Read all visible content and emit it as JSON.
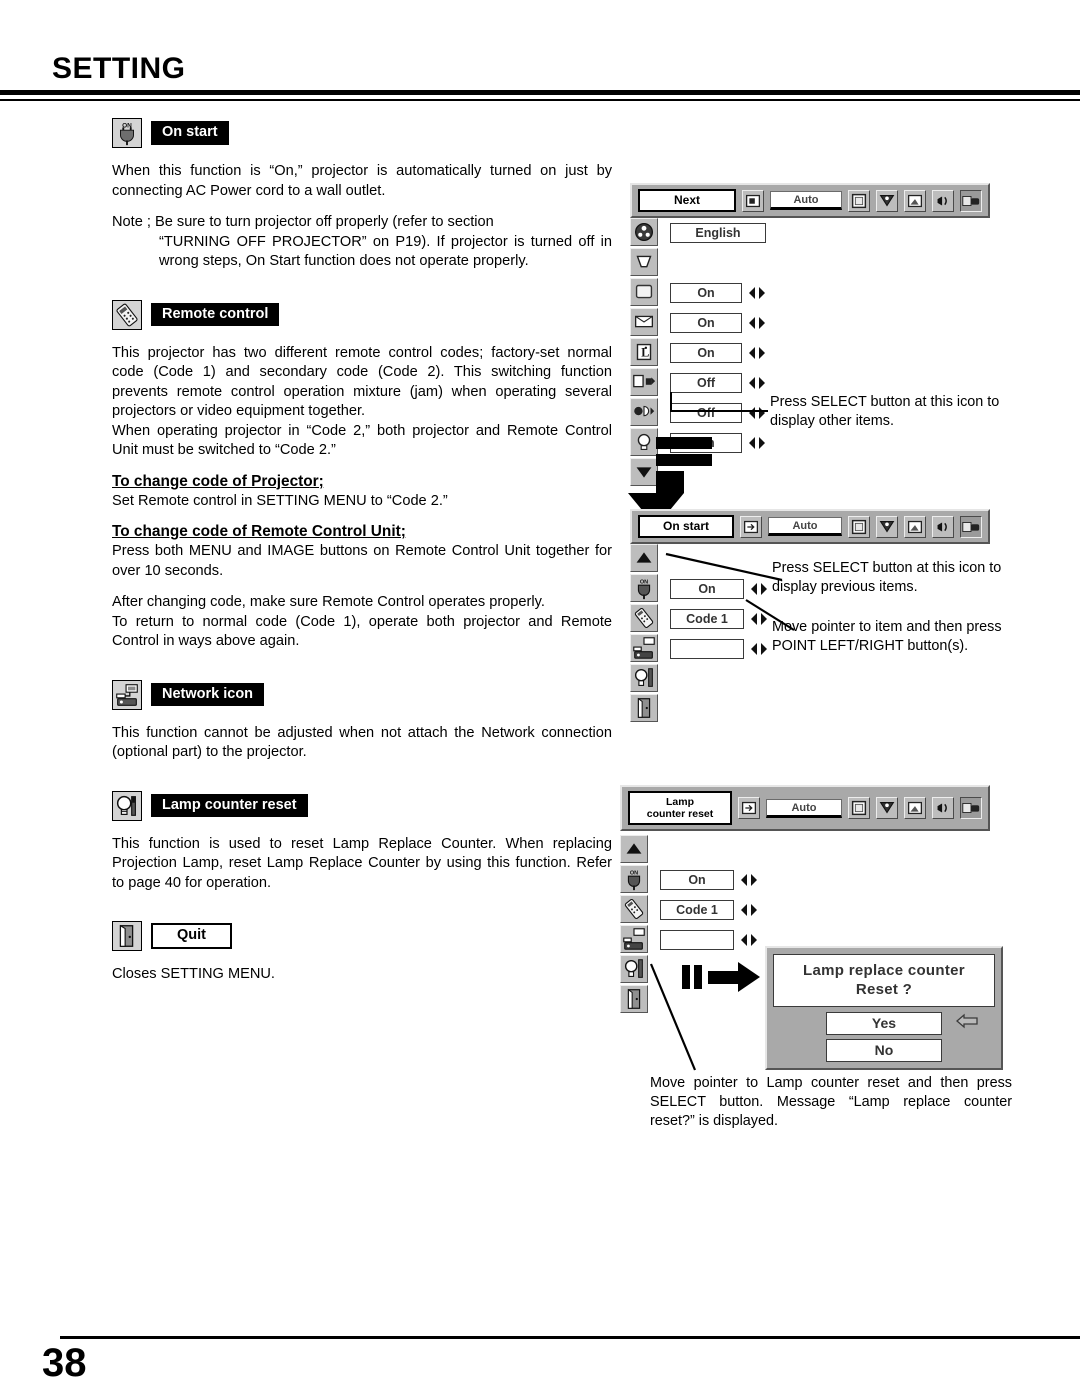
{
  "document": {
    "section_title": "SETTING",
    "page_number": "38"
  },
  "sections": [
    {
      "id": "on-start",
      "icon": "power-plug-on-icon",
      "label": "On start",
      "paragraphs": [
        "When this function is “On,” projector is automatically turned on just by connecting AC Power cord to a wall outlet."
      ],
      "note_lead": "Note ; Be sure to turn projector off properly (refer to section",
      "note_rest": "“TURNING OFF PROJECTOR” on P19).  If projector is turned off in wrong steps, On Start function does not operate properly."
    },
    {
      "id": "remote-control",
      "icon": "remote-control-icon",
      "label": "Remote control",
      "paragraphs": [
        "This projector has two different remote control codes; factory-set normal code (Code 1) and secondary code (Code 2).  This switching function prevents remote control operation mixture (jam) when operating several projectors or video equipment together.",
        "When operating projector in “Code 2,”  both projector and Remote Control Unit must be switched to “Code 2.”"
      ],
      "sub1_head": "To change code of Projector;",
      "sub1_text": "Set Remote control in SETTING MENU to “Code 2.”",
      "sub2_head": "To change code of Remote Control Unit;",
      "sub2_text": "Press both MENU and IMAGE buttons on Remote Control Unit together for over 10 seconds.",
      "after_text": "After changing code, make sure Remote Control operates properly.",
      "after_text2": "To return to normal code (Code 1), operate both projector and Remote Control in ways above again."
    },
    {
      "id": "network-icon",
      "icon": "network-projector-icon",
      "label": "Network icon",
      "paragraphs": [
        "This function cannot be adjusted when not attach the Network connection (optional part) to the projector."
      ]
    },
    {
      "id": "lamp-counter-reset",
      "icon": "lamp-tool-icon",
      "label": "Lamp counter reset",
      "paragraphs": [
        "This function is used to reset Lamp Replace Counter.  When replacing Projection Lamp, reset Lamp Replace Counter by using this function.  Refer to page 40 for operation."
      ]
    },
    {
      "id": "quit",
      "icon": "door-exit-icon",
      "label": "Quit",
      "style": "outline",
      "paragraphs": [
        "Closes SETTING MENU."
      ]
    }
  ],
  "osd_toolbar": {
    "auto_label": "Auto",
    "icons": [
      "input-source-icon",
      "screen-icon",
      "image-select-icon",
      "image-adjust-icon",
      "sound-icon",
      "setting-icon"
    ]
  },
  "menu_one": {
    "title": "Next",
    "rows": [
      {
        "icon": "language-globe-icon",
        "value": "English",
        "has_arrows": false
      },
      {
        "icon": "keystone-icon",
        "value": "",
        "has_arrows": false,
        "no_box": true
      },
      {
        "icon": "blue-back-icon",
        "value": "On",
        "has_arrows": true
      },
      {
        "icon": "display-icon",
        "value": "On",
        "has_arrows": true
      },
      {
        "icon": "logo-icon",
        "value": "On",
        "has_arrows": true
      },
      {
        "icon": "ceiling-icon",
        "value": "Off",
        "has_arrows": true
      },
      {
        "icon": "rear-icon",
        "value": "Off",
        "has_arrows": true
      },
      {
        "icon": "power-management-icon",
        "value": "On",
        "has_arrows": true
      },
      {
        "icon": "down-arrow-icon",
        "value": "",
        "has_arrows": false,
        "no_box": true
      }
    ],
    "callout": "Press SELECT button at this icon to display other items."
  },
  "menu_two": {
    "title": "On start",
    "rows": [
      {
        "icon": "up-arrow-icon",
        "value": "",
        "has_arrows": false,
        "no_box": true
      },
      {
        "icon": "power-plug-on-icon",
        "value": "On",
        "has_arrows": true
      },
      {
        "icon": "remote-control-icon",
        "value": "Code 1",
        "has_arrows": true
      },
      {
        "icon": "network-projector-icon",
        "value": "",
        "has_arrows": true
      },
      {
        "icon": "lamp-tool-icon",
        "value": "",
        "has_arrows": false,
        "no_box": true
      },
      {
        "icon": "door-exit-icon",
        "value": "",
        "has_arrows": false,
        "no_box": true
      }
    ],
    "callout_top": "Press SELECT button at this icon to display previous items.",
    "callout_bottom": "Move pointer to item and then press POINT LEFT/RIGHT button(s)."
  },
  "menu_three": {
    "title_line1": "Lamp",
    "title_line2": "counter reset",
    "rows": [
      {
        "icon": "up-arrow-icon",
        "value": "",
        "has_arrows": false,
        "no_box": true
      },
      {
        "icon": "power-plug-on-icon",
        "value": "On",
        "has_arrows": true
      },
      {
        "icon": "remote-control-icon",
        "value": "Code 1",
        "has_arrows": true
      },
      {
        "icon": "network-projector-icon",
        "value": "",
        "has_arrows": true
      },
      {
        "icon": "lamp-tool-icon",
        "value": "",
        "has_arrows": false,
        "no_box": true
      },
      {
        "icon": "door-exit-icon",
        "value": "",
        "has_arrows": false,
        "no_box": true
      }
    ],
    "caption": "Move pointer to Lamp counter reset and then press SELECT button.  Message “Lamp replace counter reset?” is displayed."
  },
  "lamp_dialog": {
    "message_line1": "Lamp replace counter",
    "message_line2": "Reset ?",
    "yes_label": "Yes",
    "no_label": "No",
    "pointer": "left-pointer-icon"
  },
  "colors": {
    "osd_gray": "#a9a9a9",
    "icon_gray": "#bdbdbd",
    "text": "#000000",
    "badge_bg": "#000000",
    "badge_text": "#ffffff"
  }
}
